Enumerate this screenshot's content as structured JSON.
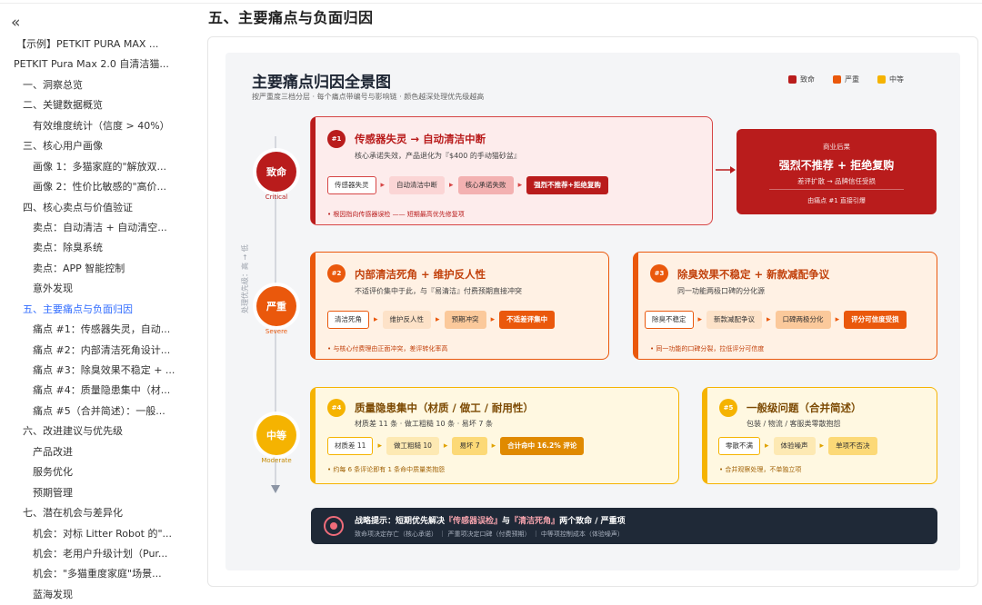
{
  "sidebar": {
    "collapse_label": "«",
    "items": [
      {
        "label": "【示例】PETKIT PURA MAX ..."
      },
      {
        "label": "PETKIT Pura Max 2.0 自清洁猫..."
      },
      {
        "label": "一、洞察总览"
      },
      {
        "label": "二、关键数据概览"
      },
      {
        "label": "有效维度统计（信度 > 40%）"
      },
      {
        "label": "三、核心用户画像"
      },
      {
        "label": "画像 1：多猫家庭的\"解放双..."
      },
      {
        "label": "画像 2：性价比敏感的\"高价..."
      },
      {
        "label": "四、核心卖点与价值验证"
      },
      {
        "label": "卖点：自动清洁 + 自动清空..."
      },
      {
        "label": "卖点：除臭系统"
      },
      {
        "label": "卖点：APP 智能控制"
      },
      {
        "label": "意外发现"
      },
      {
        "label": "五、主要痛点与负面归因"
      },
      {
        "label": "痛点 #1：传感器失灵，自动..."
      },
      {
        "label": "痛点 #2：内部清洁死角设计..."
      },
      {
        "label": "痛点 #3：除臭效果不稳定 + ..."
      },
      {
        "label": "痛点 #4：质量隐患集中（材..."
      },
      {
        "label": "痛点 #5（合并简述）：一般..."
      },
      {
        "label": "六、改进建议与优先级"
      },
      {
        "label": "产品改进"
      },
      {
        "label": "服务优化"
      },
      {
        "label": "预期管理"
      },
      {
        "label": "七、潜在机会与差异化"
      },
      {
        "label": "机会：对标 Litter Robot 的\"..."
      },
      {
        "label": "机会：老用户升级计划（Pur..."
      },
      {
        "label": "机会：\"多猫重度家庭\"场景..."
      },
      {
        "label": "蓝海发现"
      }
    ]
  },
  "section_title": "五、主要痛点与负面归因",
  "diagram": {
    "title": "主要痛点归因全景图",
    "subtitle": "按严重度三档分层 · 每个痛点带编号与影响链 · 颜色越深处理优先级越高",
    "legend": [
      {
        "label": "致命",
        "color": "#b91c1c"
      },
      {
        "label": "严重",
        "color": "#ea580c"
      },
      {
        "label": "中等",
        "color": "#f5b301"
      }
    ],
    "axis_label": "处理优先级：高 → 低",
    "levels": [
      {
        "label": "致命",
        "en": "Critical",
        "color": "#b91c1c"
      },
      {
        "label": "严重",
        "en": "Severe",
        "color": "#ea580c"
      },
      {
        "label": "中等",
        "en": "Moderate",
        "color": "#f5b301"
      }
    ],
    "card1": {
      "num": "#1",
      "title": "传感器失灵 → 自动清洁中断",
      "sub": "核心承诺失效，产品退化为『$400 的手动猫砂盆』",
      "chips": [
        "传感器失灵",
        "自动清洁中断",
        "核心承诺失败",
        "强烈不推荐+拒绝复购"
      ],
      "foot": "• 根因指向传感器误检 —— 短期最高优先修复项"
    },
    "consequence": {
      "kicker": "商业后果",
      "title": "强烈不推荐 + 拒绝复购",
      "desc": "差评扩散 → 品牌信任受损",
      "note": "由痛点 #1 直接引爆"
    },
    "card2": {
      "num": "#2",
      "title": "内部清洁死角 + 维护反人性",
      "sub": "不适评价集中于此，与『易清洁』付费预期直接冲突",
      "chips": [
        "清洁死角",
        "维护反人性",
        "预期冲突",
        "不适差评集中"
      ],
      "foot": "• 与核心付费理由正面冲突，差评转化率高"
    },
    "card3": {
      "num": "#3",
      "title": "除臭效果不稳定 + 新款减配争议",
      "sub": "同一功能两极口碑的分化源",
      "chips": [
        "除臭不稳定",
        "新款减配争议",
        "口碑两极分化",
        "评分可信度受损"
      ],
      "foot": "• 同一功能的口碑分裂，拉低评分可信度"
    },
    "card4": {
      "num": "#4",
      "title": "质量隐患集中（材质 / 做工 / 耐用性）",
      "sub": "材质差 11 条 · 做工粗糙 10 条 · 易坏 7 条",
      "chips": [
        "材质差 11",
        "做工粗糙 10",
        "易坏 7",
        "合计命中 16.2% 评论"
      ],
      "foot": "• 约每 6 条评论即有 1 条命中质量类抱怨"
    },
    "card5": {
      "num": "#5",
      "title": "一般级问题（合并简述）",
      "sub": "包装 / 物流 / 客服类零散抱怨",
      "chips": [
        "零散不满",
        "体验噪声",
        "单项不否决"
      ],
      "foot": "• 合并观察处理，不单独立项"
    },
    "tip": {
      "line_a": "战略提示：短期优先解决",
      "hl1": "『传感器误检』",
      "line_b": "与",
      "hl2": "『清洁死角』",
      "line_c": "两个致命 / 严重项",
      "detail": "致命项决定存亡（核心承诺） ｜ 严重项决定口碑（付费预期） ｜ 中等项控制成本（体验噪声）"
    }
  }
}
